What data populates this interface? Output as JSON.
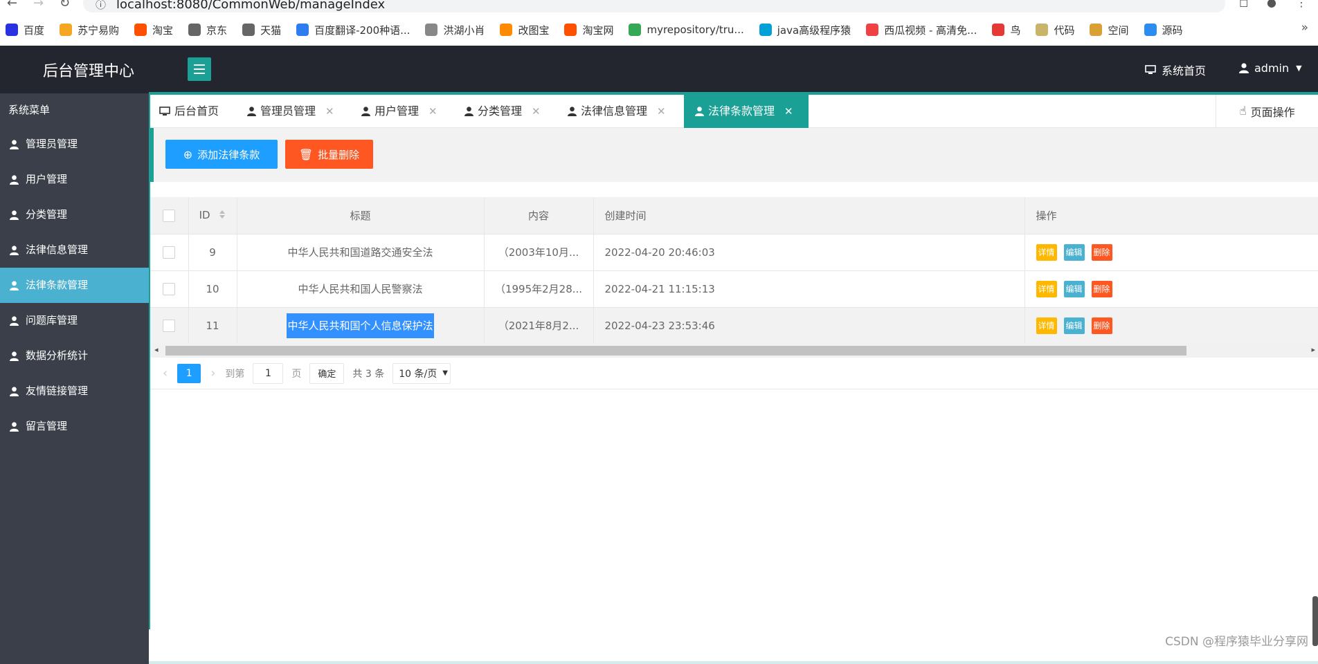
{
  "browser": {
    "url": "localhost:8080/CommonWeb/manageIndex",
    "bookmarks": [
      {
        "label": "百度",
        "color": "#2932e1"
      },
      {
        "label": "苏宁易购",
        "color": "#f5a623"
      },
      {
        "label": "淘宝",
        "color": "#ff5000"
      },
      {
        "label": "京东",
        "color": "#666666"
      },
      {
        "label": "天猫",
        "color": "#666666"
      },
      {
        "label": "百度翻译-200种语...",
        "color": "#2d7cf0"
      },
      {
        "label": "洪湖小肖",
        "color": "#888888"
      },
      {
        "label": "改图宝",
        "color": "#ff8a00"
      },
      {
        "label": "淘宝网",
        "color": "#ff5000"
      },
      {
        "label": "myrepository/tru...",
        "color": "#34a853"
      },
      {
        "label": "java高级程序猿",
        "color": "#00a1d6"
      },
      {
        "label": "西瓜视频 - 高清免...",
        "color": "#f04142"
      },
      {
        "label": "鸟",
        "color": "#e53935"
      },
      {
        "label": "代码",
        "color": "#c9b56a"
      },
      {
        "label": "空间",
        "color": "#d9a036"
      },
      {
        "label": "源码",
        "color": "#2d8cf0"
      }
    ]
  },
  "header": {
    "logo": "后台管理中心",
    "home_link": "系统首页",
    "user": "admin"
  },
  "sidebar": {
    "title": "系统菜单",
    "items": [
      {
        "label": "管理员管理"
      },
      {
        "label": "用户管理"
      },
      {
        "label": "分类管理"
      },
      {
        "label": "法律信息管理"
      },
      {
        "label": "法律条款管理"
      },
      {
        "label": "问题库管理"
      },
      {
        "label": "数据分析统计"
      },
      {
        "label": "友情链接管理"
      },
      {
        "label": "留言管理"
      }
    ]
  },
  "tabs": {
    "items": [
      {
        "label": "后台首页"
      },
      {
        "label": "管理员管理"
      },
      {
        "label": "用户管理"
      },
      {
        "label": "分类管理"
      },
      {
        "label": "法律信息管理"
      },
      {
        "label": "法律条款管理"
      }
    ],
    "page_ops": "页面操作"
  },
  "toolbar": {
    "add_label": "添加法律条款",
    "batch_delete_label": "批量删除"
  },
  "table": {
    "columns": [
      "ID",
      "标题",
      "内容",
      "创建时间",
      "操作"
    ],
    "rows": [
      {
        "id": "9",
        "title": "中华人民共和国道路交通安全法",
        "content": "（2003年10月...",
        "created": "2022-04-20 20:46:03"
      },
      {
        "id": "10",
        "title": "中华人民共和国人民警察法",
        "content": "（1995年2月28...",
        "created": "2022-04-21 11:15:13"
      },
      {
        "id": "11",
        "title": "中华人民共和国个人信息保护法",
        "content": "（2021年8月2...",
        "created": "2022-04-23 23:53:46"
      }
    ],
    "actions": {
      "detail": "详情",
      "edit": "编辑",
      "remove": "删除"
    }
  },
  "pager": {
    "current": "1",
    "goto_label": "到第",
    "goto_value": "1",
    "page_unit": "页",
    "confirm": "确定",
    "total": "共 3 条",
    "page_size": "10 条/页"
  },
  "watermark": "CSDN @程序猿毕业分享网",
  "colors": {
    "header_bg": "#23262e",
    "sidebar_bg": "#3a3f4a",
    "accent": "#1aa094",
    "active_item": "#4ab1d0",
    "primary": "#1e9fff",
    "danger": "#ff5722",
    "warning": "#ffb800"
  }
}
